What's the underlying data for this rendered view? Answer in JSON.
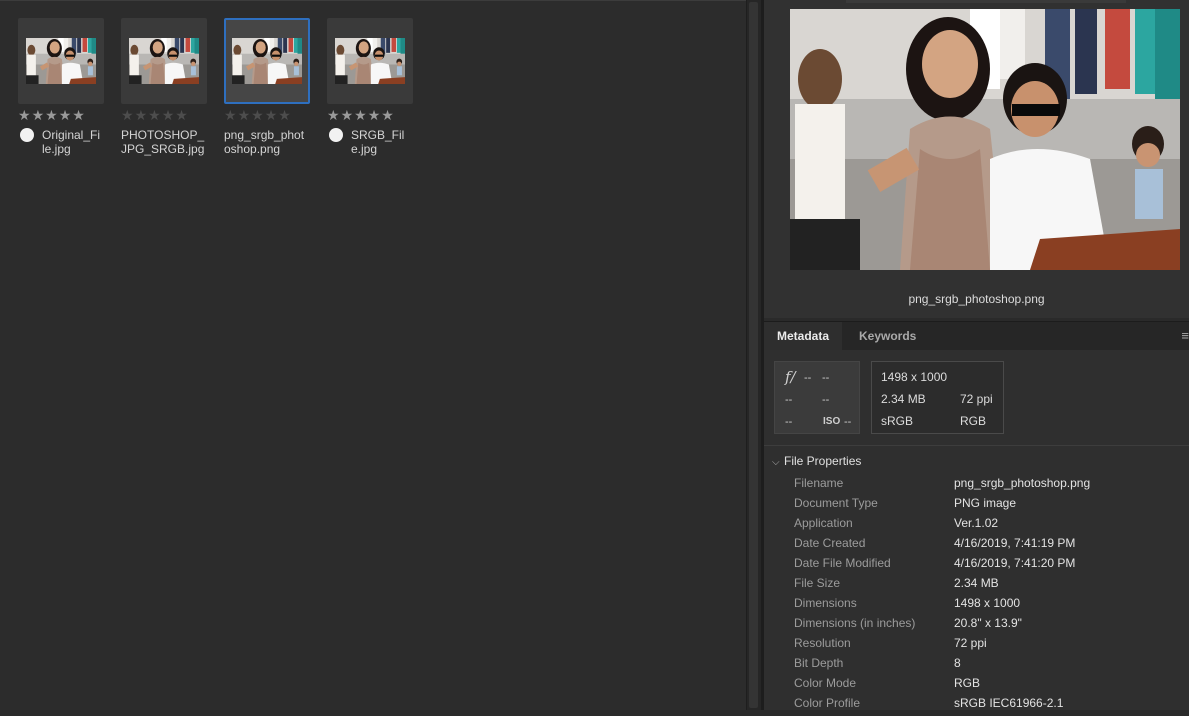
{
  "thumbnails": [
    {
      "filename": "Original_File.jpg",
      "rating": 0,
      "has_label": true,
      "selected": false
    },
    {
      "filename": "PHOTOSHOP_JPG_SRGB.jpg",
      "rating": 0,
      "has_label": false,
      "selected": false
    },
    {
      "filename": "png_srgb_photoshop.png",
      "rating": 0,
      "has_label": false,
      "selected": true
    },
    {
      "filename": "SRGB_File.jpg",
      "rating": 0,
      "has_label": true,
      "selected": false
    }
  ],
  "preview": {
    "caption": "png_srgb_photoshop.png"
  },
  "tabs": {
    "metadata": "Metadata",
    "keywords": "Keywords"
  },
  "camera_info": {
    "aperture_symbol": "f/",
    "aperture": "--",
    "shutter": "--",
    "r2a": "--",
    "r2b": "--",
    "r3a": "--",
    "iso_label": "ISO",
    "iso": "--"
  },
  "file_info": {
    "dimensions": "1498 x 1000",
    "size": "2.34 MB",
    "resolution": "72 ppi",
    "profile": "sRGB",
    "mode": "RGB"
  },
  "file_properties": {
    "header": "File Properties",
    "rows": [
      {
        "key": "Filename",
        "value": "png_srgb_photoshop.png"
      },
      {
        "key": "Document Type",
        "value": "PNG image"
      },
      {
        "key": "Application",
        "value": "Ver.1.02"
      },
      {
        "key": "Date Created",
        "value": "4/16/2019, 7:41:19 PM"
      },
      {
        "key": "Date File Modified",
        "value": "4/16/2019, 7:41:20 PM"
      },
      {
        "key": "File Size",
        "value": "2.34 MB"
      },
      {
        "key": "Dimensions",
        "value": "1498 x 1000"
      },
      {
        "key": "Dimensions (in inches)",
        "value": "20.8\" x 13.9\""
      },
      {
        "key": "Resolution",
        "value": "72 ppi"
      },
      {
        "key": "Bit Depth",
        "value": "8"
      },
      {
        "key": "Color Mode",
        "value": "RGB"
      },
      {
        "key": "Color Profile",
        "value": "sRGB IEC61966-2.1"
      }
    ]
  },
  "colors": {
    "selection_border": "#2e6fbf",
    "panel_bg": "#2c2c2c"
  }
}
